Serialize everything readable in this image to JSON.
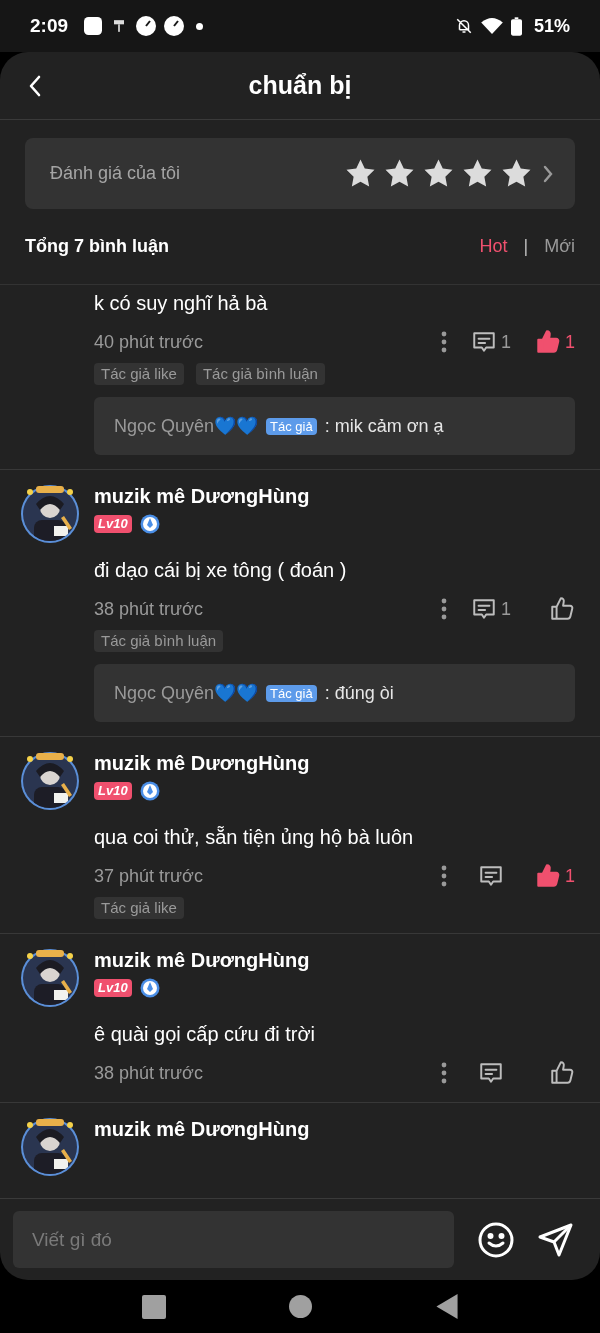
{
  "status_bar": {
    "time": "2:09",
    "battery": "51%"
  },
  "header": {
    "title": "chuẩn bị"
  },
  "my_rating": {
    "label": "Đánh giá của tôi",
    "stars": 5
  },
  "comments_header": {
    "total": "Tổng 7 bình luận",
    "sort_tabs": [
      {
        "label": "Hot",
        "selected": true
      },
      {
        "label": "Mới",
        "selected": false
      }
    ],
    "separator": "|"
  },
  "comments": [
    {
      "text": "k có suy nghĩ hả bà",
      "time": "40 phút trước",
      "reply_count": "1",
      "liked": true,
      "like_count": "1",
      "tags": [
        "Tác giả like",
        "Tác giả bình luận"
      ],
      "reply": {
        "author": "Ngọc Quyên💙💙",
        "badge": "Tác giả",
        "text": ": mik cảm ơn ạ"
      }
    },
    {
      "user": "muzik mê DươngHùng",
      "level": "Lv10",
      "text": "đi dạo cái bị xe tông ( đoán )",
      "time": "38 phút trước",
      "reply_count": "1",
      "liked": false,
      "tags": [
        "Tác giả bình luận"
      ],
      "reply": {
        "author": "Ngọc Quyên💙💙",
        "badge": "Tác giả",
        "text": ": đúng òi"
      }
    },
    {
      "user": "muzik mê DươngHùng",
      "level": "Lv10",
      "text": "qua coi thử, sẵn tiện ủng hộ bà luôn",
      "time": "37 phút trước",
      "liked": true,
      "like_count": "1",
      "tags": [
        "Tác giả like"
      ]
    },
    {
      "user": "muzik mê DươngHùng",
      "level": "Lv10",
      "text": "ê quài gọi cấp cứu đi trời",
      "time": "38 phút trước",
      "liked": false
    },
    {
      "user": "muzik mê DươngHùng"
    }
  ],
  "composer": {
    "placeholder": "Viết gì đó"
  }
}
